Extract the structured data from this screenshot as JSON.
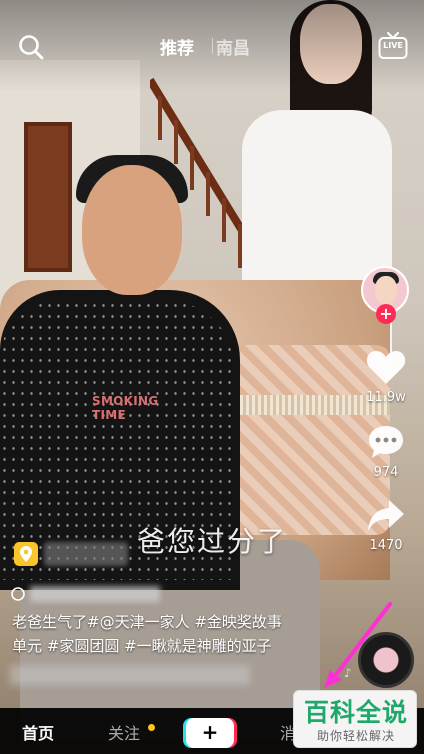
{
  "header": {
    "tabs": [
      {
        "label": "推荐",
        "active": true
      },
      {
        "label": "南昌",
        "active": false
      }
    ],
    "live_label": "LIVE"
  },
  "video": {
    "shirt_text": "SMOKING TIME",
    "subtitle": "爸您过分了"
  },
  "actions": {
    "likes": "11.9w",
    "comments": "974",
    "shares": "1470"
  },
  "post": {
    "description_line1": "老爸生气了#@天津一家人 #金映奖故事",
    "description_line2": "单元 #家圆团圆 #一瞅就是神雕的亚子"
  },
  "bottom_nav": {
    "home": "首页",
    "following": "关注",
    "create": "+",
    "messages": "消"
  },
  "watermark": {
    "title": "百科全说",
    "subtitle": "助你轻松解决"
  },
  "colors": {
    "accent_red": "#fe2c55",
    "accent_cyan": "#27e1e8",
    "poi_yellow": "#f9c52a",
    "watermark_green": "#1fa86a"
  }
}
